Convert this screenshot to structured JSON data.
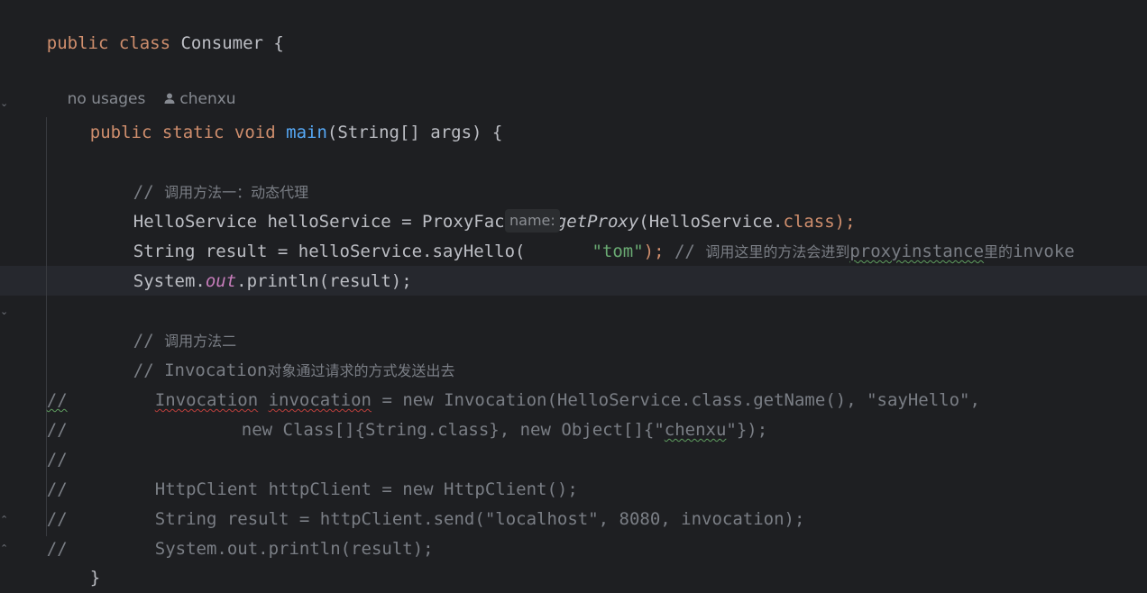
{
  "editor": {
    "line_class": {
      "kw": "public class",
      "name": " Consumer {"
    },
    "hints": {
      "usages": "no usages",
      "author": "chenxu"
    },
    "main_decl": {
      "kw": "public static void",
      "name": "main",
      "rest": "(String[] args) {"
    },
    "comment1": {
      "slashes": "// ",
      "text": "调用方法一：动态代理"
    },
    "proxy_line": {
      "a": "HelloService helloService = ProxyFactory.",
      "method": "getProxy",
      "b": "(HelloService.",
      "kw": "class",
      "c": ");"
    },
    "result_line": {
      "a": "String result = helloService.sayHello(",
      "inlay": "name:",
      "str": "\"tom\"",
      "c": ");",
      "cmt_slashes": " // ",
      "cmt_text_1": "调用这里的方法会进到",
      "cmt_code_1": "proxyinstance",
      "cmt_text_2": "里的",
      "cmt_code_2": "invoke"
    },
    "println_line": {
      "a": "System.",
      "field": "out",
      "b": ".println(result);"
    },
    "comment2": {
      "slashes": "// ",
      "text": "调用方法二"
    },
    "comment3": {
      "prefix": "// Invocation",
      "text": "对象通过请求的方式发送出去"
    },
    "commented": {
      "l1_prefix": "//",
      "l1_a": "Invocation",
      "l1_b": "invocation",
      "l1_c": " = new Invocation(HelloService.class.getName(), \"sayHello\",",
      "l2_prefix": "//",
      "l2_a": "new Class[]{String.class}, new Object[]{\"",
      "l2_b": "chenxu",
      "l2_c": "\"});",
      "l3_prefix": "//",
      "l4_prefix": "//",
      "l4_a": "HttpClient httpClient = new HttpClient();",
      "l5_prefix": "//",
      "l5_a": "String result = httpClient.send(\"localhost\", 8080, invocation);",
      "l6_prefix": "//",
      "l6_a": "System.out.println(result);"
    },
    "close_method": "}",
    "close_class": "}"
  }
}
